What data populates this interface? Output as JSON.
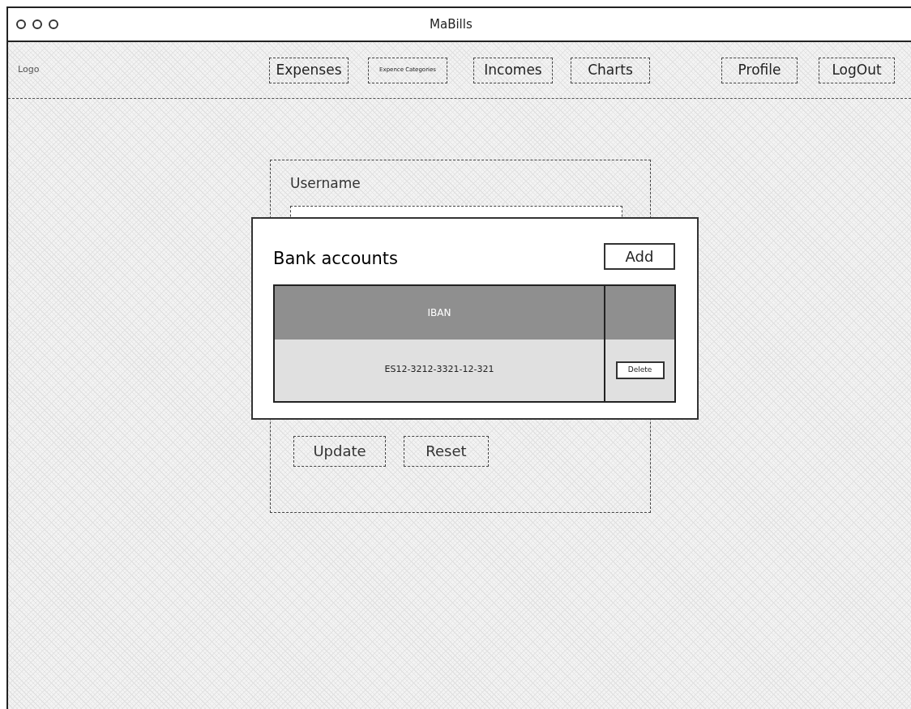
{
  "window": {
    "title": "MaBills"
  },
  "nav": {
    "logo": "Logo",
    "items": [
      {
        "label": "Expenses",
        "kind": "normal"
      },
      {
        "label": "Expence Categories",
        "kind": "small"
      },
      {
        "label": "Incomes",
        "kind": "normal"
      },
      {
        "label": "Charts",
        "kind": "normal"
      }
    ],
    "account_items": [
      {
        "label": "Profile"
      },
      {
        "label": "LogOut"
      }
    ]
  },
  "form": {
    "label": "Username",
    "buttons": [
      "Update",
      "Reset"
    ]
  },
  "modal": {
    "title": "Bank accounts",
    "add_button": "Add",
    "table": {
      "columns": [
        "IBAN"
      ],
      "rows": [
        {
          "iban": "ES12-3212-3321-12-321",
          "action": "Delete"
        }
      ]
    }
  }
}
